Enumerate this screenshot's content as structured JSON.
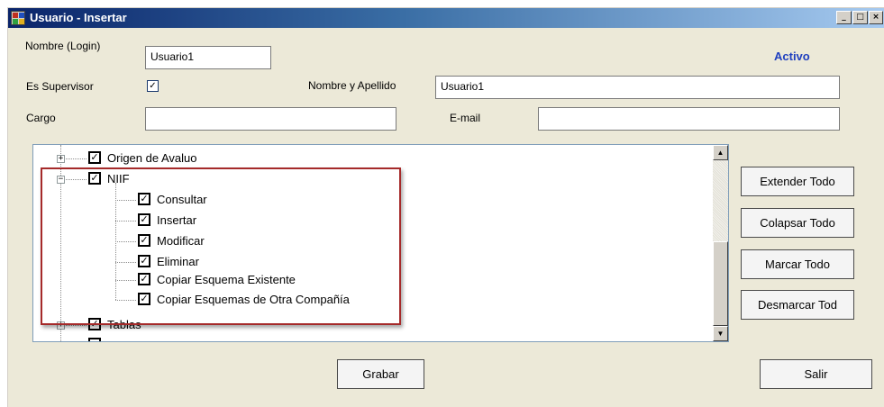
{
  "window": {
    "title": "Usuario - Insertar",
    "minimize_glyph": "_",
    "maximize_glyph": "□",
    "close_glyph": "×"
  },
  "form": {
    "login_label": "Nombre (Login)",
    "login_value": "Usuario1",
    "status_label": "Activo",
    "supervisor_label": "Es Supervisor",
    "supervisor_checked": true,
    "fullname_label": "Nombre y Apellido",
    "fullname_value": "Usuario1",
    "cargo_label": "Cargo",
    "cargo_value": "",
    "email_label": "E-mail",
    "email_value": ""
  },
  "tree": {
    "nodes": [
      {
        "label": "Origen de Avaluo",
        "checked": true,
        "expander": "+"
      },
      {
        "label": "NIIF",
        "checked": true,
        "expander": "−"
      },
      {
        "label": "Consultar",
        "checked": true
      },
      {
        "label": "Insertar",
        "checked": true
      },
      {
        "label": "Modificar",
        "checked": true
      },
      {
        "label": "Eliminar",
        "checked": true
      },
      {
        "label": "Copiar Esquema Existente",
        "checked": true
      },
      {
        "label": "Copiar Esquemas de Otra Compañía",
        "checked": true
      },
      {
        "label": "Tablas",
        "checked": true,
        "expander": "+"
      }
    ],
    "scroll_up_glyph": "▲",
    "scroll_down_glyph": "▼"
  },
  "buttons": {
    "expand_all": "Extender Todo",
    "collapse_all": "Colapsar Todo",
    "check_all": "Marcar Todo",
    "uncheck_all": "Desmarcar Tod",
    "save": "Grabar",
    "exit": "Salir"
  },
  "colors": {
    "status_accent": "#1f3fbf",
    "highlight_border": "#a52a2a",
    "titlebar_start": "#0a246a"
  },
  "icons": {
    "app": "app-icon",
    "checkbox": "checkbox-checked-icon",
    "expand": "plus-box-icon",
    "collapse": "minus-box-icon"
  }
}
